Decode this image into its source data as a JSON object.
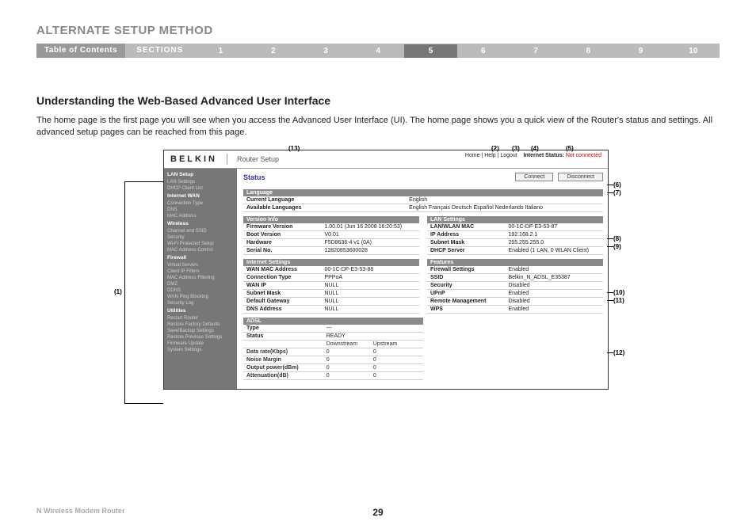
{
  "header": {
    "title": "ALTERNATE SETUP METHOD",
    "toc": "Table of Contents",
    "sections": "SECTIONS",
    "nums": [
      "1",
      "2",
      "3",
      "4",
      "5",
      "6",
      "7",
      "8",
      "9",
      "10"
    ],
    "active_idx": 4
  },
  "subsection": "Understanding the Web-Based Advanced User Interface",
  "body": "The home page is the first page you will see when you access the Advanced User Interface (UI). The home page shows you a quick view of the Router's status and settings. All advanced setup pages can be reached from this page.",
  "shot": {
    "brand": "BELKIN",
    "setup": "Router Setup",
    "top_links": "Home | Help | Logout",
    "internet_status_label": "Internet Status:",
    "internet_status_value": "Not connected",
    "status_label": "Status",
    "btn_connect": "Connect",
    "btn_disconnect": "Disconnect",
    "sidebar": [
      {
        "h": "LAN Setup"
      },
      {
        "i": "LAN Settings"
      },
      {
        "i": "DHCP Client List"
      },
      {
        "h": "Internet WAN"
      },
      {
        "i": "Connection Type"
      },
      {
        "i": "DNS"
      },
      {
        "i": "MAC Address"
      },
      {
        "h": "Wireless"
      },
      {
        "i": "Channel and SSID"
      },
      {
        "i": "Security"
      },
      {
        "i": "Wi-Fi Protected Setup"
      },
      {
        "i": "MAC Address Control"
      },
      {
        "h": "Firewall"
      },
      {
        "i": "Virtual Servers"
      },
      {
        "i": "Client IP Filters"
      },
      {
        "i": "MAC Address Filtering"
      },
      {
        "i": "DMZ"
      },
      {
        "i": "DDNS"
      },
      {
        "i": "WAN Ping Blocking"
      },
      {
        "i": "Security Log"
      },
      {
        "h": "Utilities"
      },
      {
        "i": "Restart Router"
      },
      {
        "i": "Restore Factory Defaults"
      },
      {
        "i": "Save/Backup Settings"
      },
      {
        "i": "Restore Previous Settings"
      },
      {
        "i": "Firmware Update"
      },
      {
        "i": "System Settings"
      }
    ],
    "sections": {
      "language": {
        "title": "Language",
        "rows": [
          {
            "k": "Current Language",
            "v": "English"
          },
          {
            "k": "Available Languages",
            "v": "English  Français  Deutsch  Español  Nederlands  Italiano"
          }
        ]
      },
      "version": {
        "title": "Version Info",
        "rows": [
          {
            "k": "Firmware Version",
            "v": "1.00.01 (Jun 16 2008 16:20:53)"
          },
          {
            "k": "Boot Version",
            "v": "V0.01"
          },
          {
            "k": "Hardware",
            "v": "F5D8636-4 v1 (0A)"
          },
          {
            "k": "Serial No.",
            "v": "12820853600028"
          }
        ]
      },
      "lan": {
        "title": "LAN Settings",
        "rows": [
          {
            "k": "LAN/WLAN MAC",
            "v": "00-1C-DF-E3-53-87"
          },
          {
            "k": "IP Address",
            "v": "192.168.2.1"
          },
          {
            "k": "Subnet Mask",
            "v": "255.255.255.0"
          },
          {
            "k": "DHCP Server",
            "v": "Enabled (1 LAN, 0 WLAN Client)"
          }
        ]
      },
      "internet": {
        "title": "Internet Settings",
        "rows": [
          {
            "k": "WAN MAC Address",
            "v": "00-1C-DF-E3-53-88"
          },
          {
            "k": "Connection Type",
            "v": "PPPoA"
          },
          {
            "k": "WAN IP",
            "v": "NULL"
          },
          {
            "k": "Subnet Mask",
            "v": "NULL"
          },
          {
            "k": "Default Gateway",
            "v": "NULL"
          },
          {
            "k": "DNS Address",
            "v": "NULL"
          }
        ]
      },
      "features": {
        "title": "Features",
        "rows": [
          {
            "k": "Firewall Settings",
            "v": "Enabled"
          },
          {
            "k": "SSID",
            "v": "Belkin_N_ADSL_E35387"
          },
          {
            "k": "Security",
            "v": "Disabled"
          },
          {
            "k": "UPnP",
            "v": "Enabled"
          },
          {
            "k": "Remote Management",
            "v": "Disabled"
          },
          {
            "k": "WPS",
            "v": "Enabled"
          }
        ]
      },
      "adsl": {
        "title": "ADSL",
        "rows1": [
          {
            "k": "Type",
            "v": "---"
          },
          {
            "k": "Status",
            "v": "READY"
          }
        ],
        "cols": {
          "c1": "Downstream",
          "c2": "Upstream"
        },
        "rows2": [
          {
            "k": "Data rate(Kbps)",
            "c1": "0",
            "c2": "0"
          },
          {
            "k": "Noise Margin",
            "c1": "0",
            "c2": "0"
          },
          {
            "k": "Output power(dBm)",
            "c1": "0",
            "c2": "0"
          },
          {
            "k": "Attenuation(dB)",
            "c1": "0",
            "c2": "0"
          }
        ]
      }
    }
  },
  "callouts": {
    "c13": "(13)",
    "c2": "(2)",
    "c3": "(3)",
    "c4": "(4)",
    "c5": "(5)",
    "c1": "(1)",
    "c6": "(6)",
    "c7": "(7)",
    "c8": "(8)",
    "c9": "(9)",
    "c10": "(10)",
    "c11": "(11)",
    "c12": "(12)"
  },
  "footer": {
    "left": "N Wireless Modem Router",
    "page": "29"
  }
}
